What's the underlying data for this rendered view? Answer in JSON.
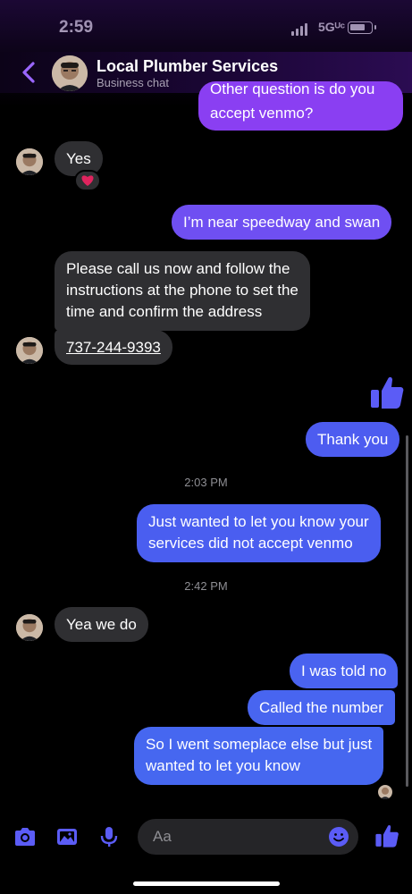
{
  "status": {
    "time": "2:59",
    "network": "5Gᵁᶜ"
  },
  "header": {
    "title": "Local Plumber Services",
    "subtitle": "Business chat"
  },
  "colors": {
    "accent": "#5b5cf6",
    "incoming": "#2f2f32",
    "outgoing_top": "#8a3ff2",
    "outgoing_bottom": "#4d62f0"
  },
  "messages": {
    "out_partial_l1": "Other question is do you",
    "out_partial_l2": "accept  venmo?",
    "in_yes": "Yes",
    "reaction": "heart",
    "out_speedway": "I’m near speedway and swan",
    "in_call_l1": "Please call us now and follow the",
    "in_call_l2": "instructions at the phone to set the",
    "in_call_l3": "time and confirm the address",
    "in_phone": "737-244-9393",
    "out_thanks": "Thank you",
    "ts1": "2:03 PM",
    "out_venmo_l1": "Just wanted to let you know your",
    "out_venmo_l2": "services did not accept venmo",
    "ts2": "2:42 PM",
    "in_yea": "Yea we do",
    "out_told": "I was told no",
    "out_called": "Called the number",
    "out_last_l1": "So I went someplace else but just",
    "out_last_l2": "wanted to let you know"
  },
  "composer": {
    "placeholder": "Aa",
    "icons": [
      "camera-icon",
      "photo-icon",
      "microphone-icon",
      "emoji-icon",
      "thumbs-up-icon"
    ]
  }
}
